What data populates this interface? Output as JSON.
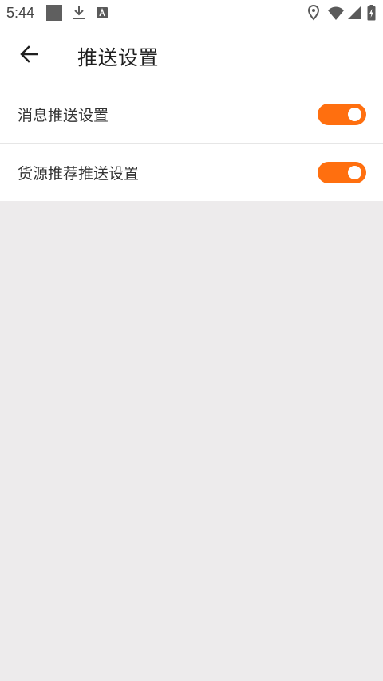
{
  "status_bar": {
    "time": "5:44",
    "icons": [
      "notification-square-icon",
      "download-icon",
      "a-icon",
      "location-icon",
      "wifi-icon",
      "signal-icon",
      "battery-icon"
    ]
  },
  "app_bar": {
    "title": "推送设置",
    "back_icon": "arrow-left-icon"
  },
  "settings": [
    {
      "label": "消息推送设置",
      "enabled": true
    },
    {
      "label": "货源推荐推送设置",
      "enabled": true
    }
  ],
  "colors": {
    "accent": "#ff6f0f",
    "background": "#edebec",
    "surface": "#ffffff"
  }
}
